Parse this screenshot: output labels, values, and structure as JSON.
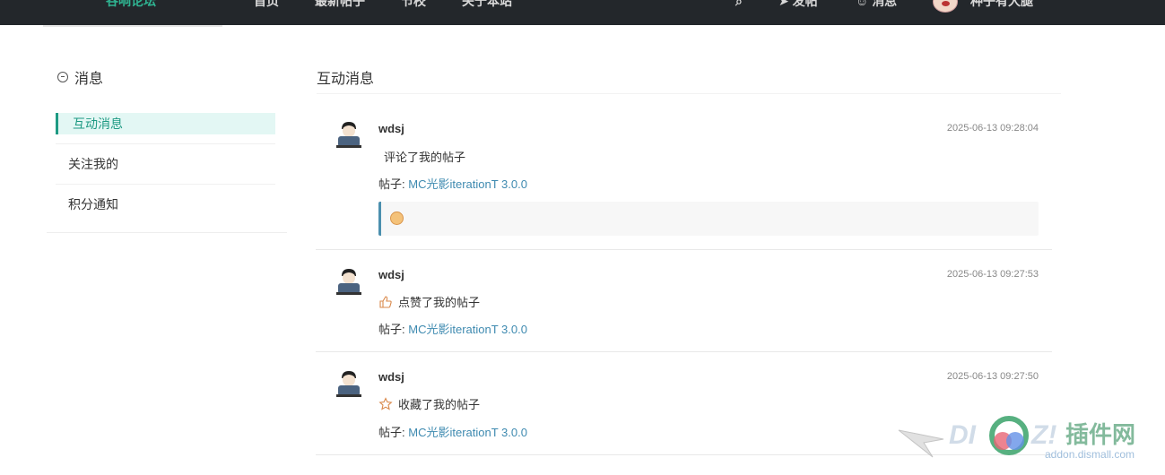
{
  "topnav": {
    "brand": "谷响论坛",
    "links": [
      "首页",
      "最新帖子",
      "节校",
      "关于本站"
    ],
    "post_label": "发帖",
    "message_label": "消息",
    "username": "种子有大腿"
  },
  "sidebar": {
    "title": "消息",
    "items": [
      {
        "label": "互动消息",
        "active": true
      },
      {
        "label": "关注我的",
        "active": false
      },
      {
        "label": "积分通知",
        "active": false
      }
    ]
  },
  "main": {
    "title": "互动消息",
    "messages": [
      {
        "user": "wdsj",
        "time": "2025-06-13 09:28:04",
        "action": "评论了我的帖子",
        "post_prefix": "帖子:",
        "post_title": "MC光影iterationT 3.0.0",
        "has_quote": true
      },
      {
        "user": "wdsj",
        "time": "2025-06-13 09:27:53",
        "action": "点赞了我的帖子",
        "post_prefix": "帖子:",
        "post_title": "MC光影iterationT 3.0.0",
        "icon": "thumbs-up-icon"
      },
      {
        "user": "wdsj",
        "time": "2025-06-13 09:27:50",
        "action": "收藏了我的帖子",
        "post_prefix": "帖子:",
        "post_title": "MC光影iterationT 3.0.0",
        "icon": "star-icon"
      }
    ]
  },
  "watermark": {
    "brand": "DISCUZ!",
    "cn": "插件网",
    "domain": "addon.dismall.com"
  },
  "colors": {
    "accent": "#1e9a83",
    "link": "#3e8ab0",
    "nav_bg": "#23272b",
    "active_bg": "#e3f7f4"
  }
}
